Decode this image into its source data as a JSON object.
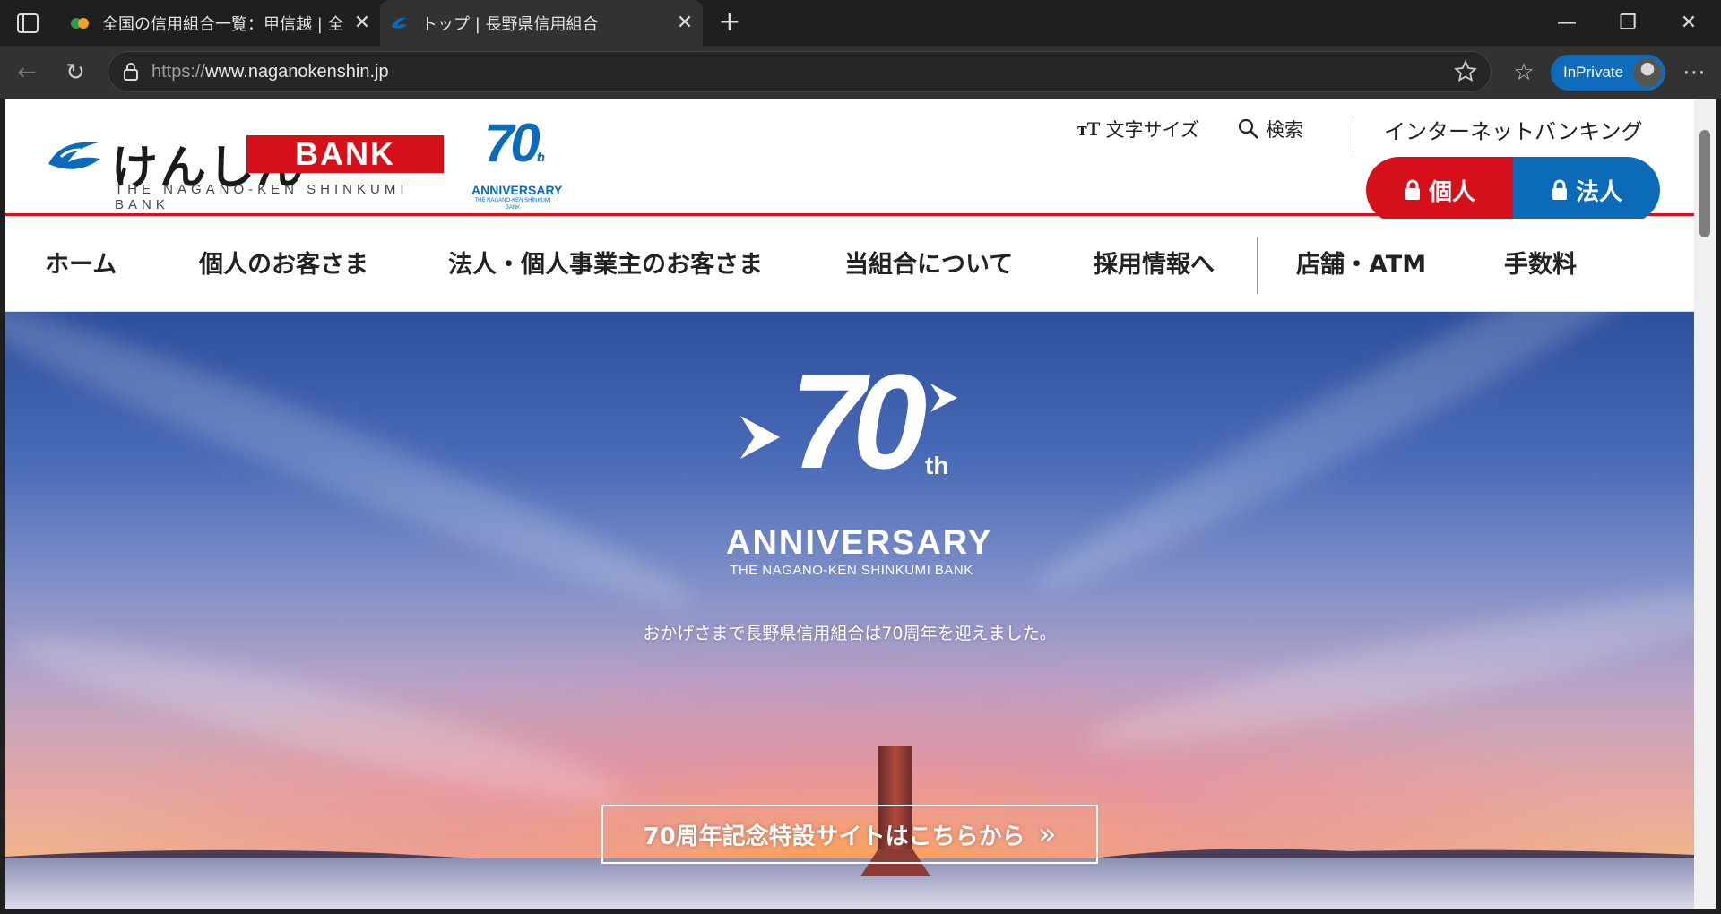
{
  "browser": {
    "tabs": [
      {
        "title": "全国の信用組合一覧：甲信越 | 全国信用組合中央協会",
        "active": false
      },
      {
        "title": "トップ | 長野県信用組合",
        "active": true
      }
    ],
    "url_protocol": "https://",
    "url_host": "www.naganokenshin.jp",
    "inprivate_label": "InPrivate"
  },
  "header": {
    "logo_name": "けんしん",
    "logo_bank": "BANK",
    "logo_sub": "THE NAGANO-KEN SHINKUMI BANK",
    "anniv_small_number": "70",
    "anniv_small_th": "th",
    "anniv_small_label": "ANNIVERSARY",
    "anniv_small_sub": "THE NAGANO-KEN SHINKUMI BANK",
    "font_size_label": "文字サイズ",
    "search_label": "検索",
    "internet_banking_label": "インターネットバンキング",
    "personal_label": "個人",
    "corporate_label": "法人"
  },
  "nav": {
    "items": [
      {
        "label": "ホーム"
      },
      {
        "label": "個人のお客さま"
      },
      {
        "label": "法人・個人事業主のお客さま"
      },
      {
        "label": "当組合について"
      },
      {
        "label": "採用情報へ"
      },
      {
        "label": "店舗・ATM"
      },
      {
        "label": "手数料"
      }
    ]
  },
  "hero": {
    "number": "70",
    "number_suffix": "th",
    "anniversary": "ANNIVERSARY",
    "bank_name": "THE NAGANO-KEN SHINKUMI BANK",
    "caption": "おかげさまで長野県信用組合は70周年を迎えました。",
    "cta_label": "70周年記念特設サイトはこちらから",
    "cta_arrow": "»"
  },
  "colors": {
    "brand_red": "#d5101b",
    "brand_blue": "#0c6bb8"
  }
}
